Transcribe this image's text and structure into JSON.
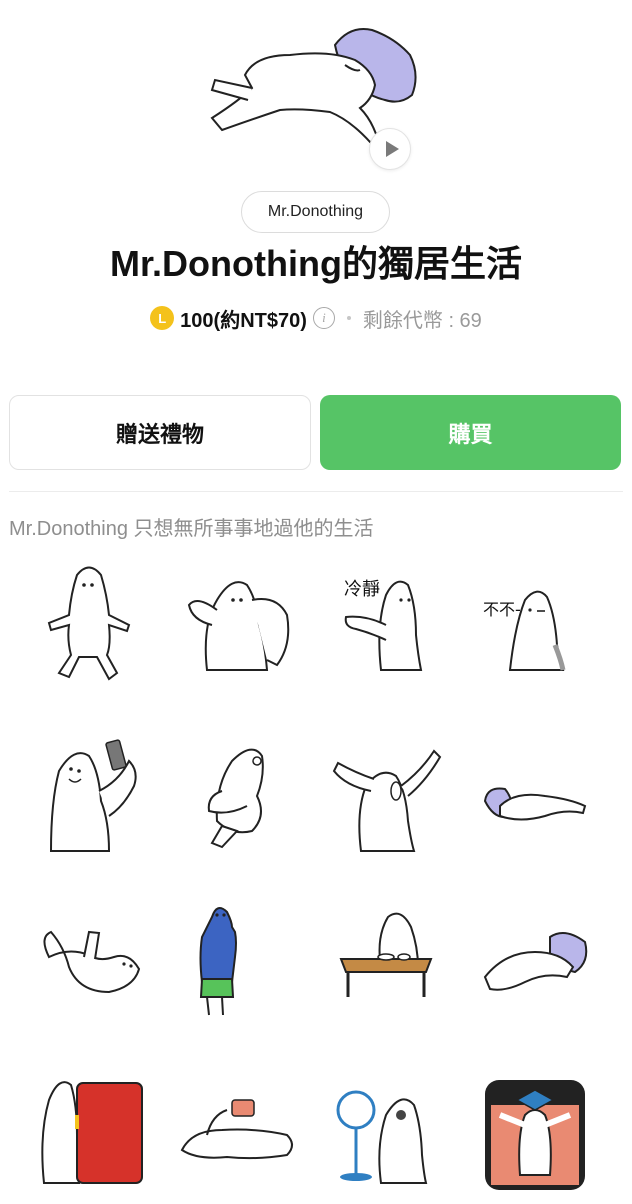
{
  "preview": {
    "play_icon": "play-icon"
  },
  "author": "Mr.Donothing",
  "title": "Mr.Donothing的獨居生活",
  "price": {
    "coin_letter": "L",
    "amount_text": "100(約NT$70)",
    "info_icon": "i",
    "balance_text": "剩餘代幣 : 69"
  },
  "buttons": {
    "gift": "贈送禮物",
    "buy": "購買"
  },
  "description": "Mr.Donothing 只想無所事事地過他的生活",
  "stickers": {
    "s3_text": "冷靜",
    "s4_text": "不不-"
  },
  "colors": {
    "buy_button": "#56c466",
    "coin": "#f4c21b",
    "pillow": "#b9b6ea",
    "hoodie": "#3c64c2",
    "shorts": "#57c35a",
    "fridge": "#d6322a",
    "table": "#c48a45",
    "fan": "#2f7fc2",
    "blanket": "#e98a72"
  }
}
